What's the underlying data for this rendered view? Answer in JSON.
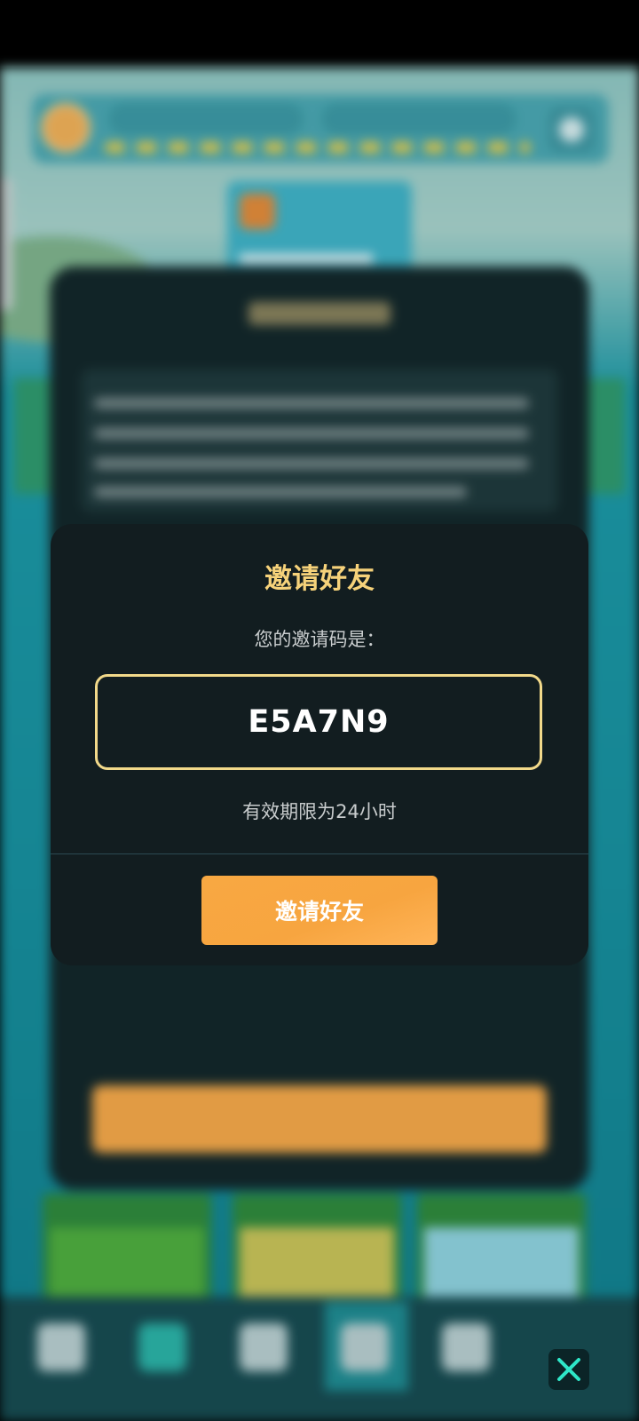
{
  "modal": {
    "title": "邀请好友",
    "code_label": "您的邀请码是：",
    "code": "E5A7N9",
    "validity": "有效期限为24小时",
    "invite_button": "邀请好友"
  },
  "colors": {
    "modal_bg": "#121d20",
    "title": "#f6d27a",
    "code_border": "#f2d98a",
    "button": "#f7a540",
    "close_icon": "#2ee6c8"
  },
  "icons": {
    "close": "close-icon"
  }
}
